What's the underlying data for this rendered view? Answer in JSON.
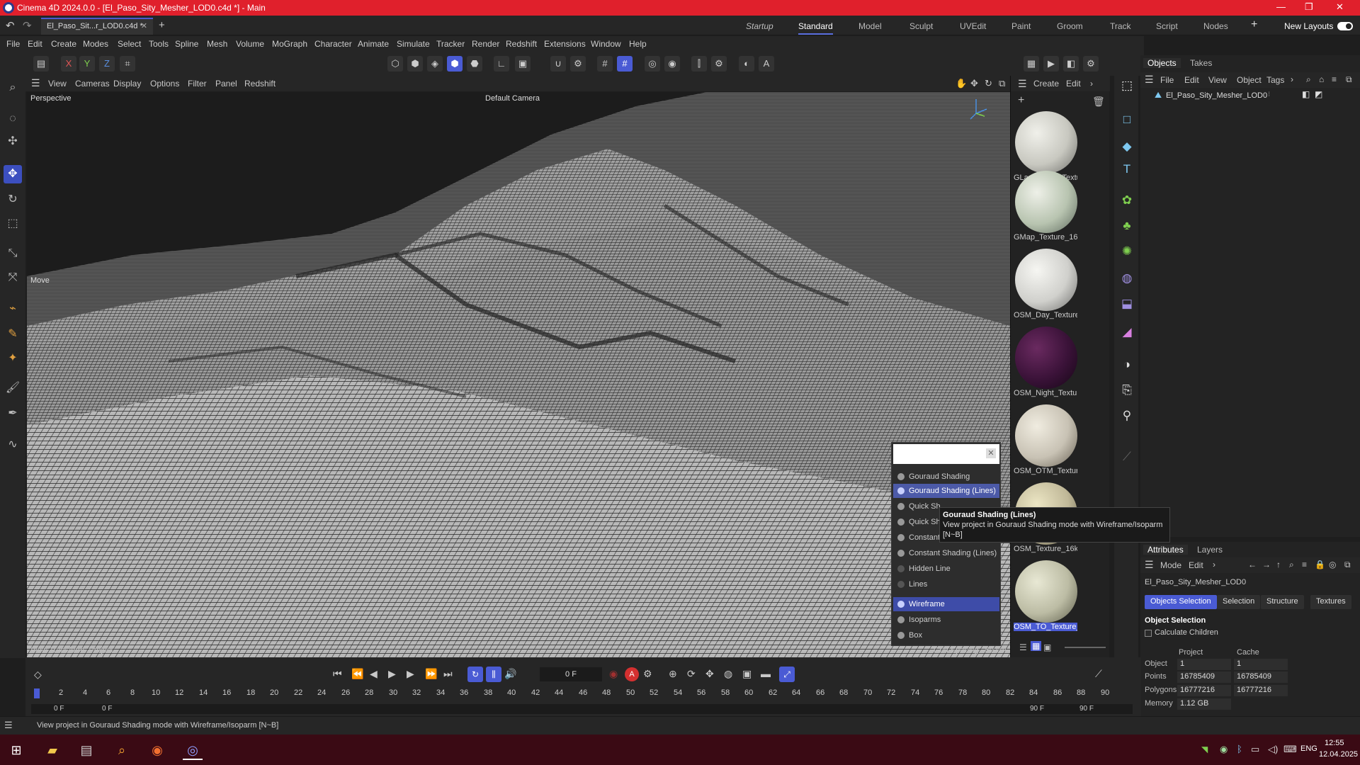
{
  "window": {
    "title": "Cinema 4D 2024.0.0 - [El_Paso_Sity_Mesher_LOD0.c4d *] - Main"
  },
  "doc_tab": {
    "label": "El_Paso_Sit...r_LOD0.c4d *",
    "close": "✕",
    "add": "+"
  },
  "layouts": [
    {
      "label": "Startup",
      "italic": true
    },
    {
      "label": "Standard",
      "active": true
    },
    {
      "label": "Model"
    },
    {
      "label": "Sculpt"
    },
    {
      "label": "UVEdit"
    },
    {
      "label": "Paint"
    },
    {
      "label": "Groom"
    },
    {
      "label": "Track"
    },
    {
      "label": "Script"
    },
    {
      "label": "Nodes"
    }
  ],
  "new_layouts": "New Layouts",
  "menu": [
    "File",
    "Edit",
    "Create",
    "Modes",
    "Select",
    "Tools",
    "Spline",
    "Mesh",
    "Volume",
    "MoGraph",
    "Character",
    "Animate",
    "Simulate",
    "Tracker",
    "Render",
    "Redshift",
    "Extensions",
    "Window",
    "Help"
  ],
  "axes": {
    "x": "X",
    "y": "Y",
    "z": "Z"
  },
  "viewport_menu": [
    "View",
    "Cameras",
    "Display",
    "Options",
    "Filter",
    "Panel",
    "Redshift"
  ],
  "viewport": {
    "projection": "Perspective",
    "camera": "Default Camera",
    "move_label": "Move",
    "view_transform": "View Transform: Project",
    "grid_spacing": "Grid Spacing : 50 cm"
  },
  "shading_menu": {
    "items": [
      {
        "label": "Gouraud Shading"
      },
      {
        "label": "Gouraud Shading (Lines)",
        "highlighted": true
      },
      {
        "label": "Quick Sh"
      },
      {
        "label": "Quick Sh"
      },
      {
        "label": "Constant"
      },
      {
        "label": "Constant Shading (Lines)"
      },
      {
        "label": "Hidden Line"
      },
      {
        "label": "Lines"
      },
      {
        "label": "Wireframe",
        "selected": true
      },
      {
        "label": "Isoparms"
      },
      {
        "label": "Box"
      }
    ]
  },
  "tooltip": {
    "title": "Gouraud Shading (Lines)",
    "line1": "View project in Gouraud Shading  mode with Wireframe/Isoparm",
    "line2": "[N~B]"
  },
  "material_panel": {
    "menu": [
      "Create",
      "Edit"
    ],
    "materials": [
      {
        "label": "GLandscape_Textu",
        "color": "#c8c8c0"
      },
      {
        "label": "GMap_Texture_16",
        "color": "#b8c4b0"
      },
      {
        "label": "OSM_Day_Texture",
        "color": "#d0d0cc"
      },
      {
        "label": "OSM_Night_Textu",
        "color": "#3a1238"
      },
      {
        "label": "OSM_OTM_Textur",
        "color": "#c8c2b4"
      },
      {
        "label": "OSM_Texture_16k",
        "color": "#c0b898"
      },
      {
        "label": "OSM_TO_Texture_",
        "color": "#bcbca4",
        "selected": true
      }
    ]
  },
  "objects_panel": {
    "tabs": [
      "Objects",
      "Takes"
    ],
    "menu": [
      "File",
      "Edit",
      "View",
      "Object",
      "Tags"
    ],
    "items": [
      {
        "label": "El_Paso_Sity_Mesher_LOD0"
      }
    ]
  },
  "attributes_panel": {
    "tabs": [
      "Attributes",
      "Layers"
    ],
    "menu": [
      "Mode",
      "Edit"
    ],
    "object_name": "El_Paso_Sity_Mesher_LOD0",
    "subtabs": [
      {
        "label": "Objects Selection",
        "active": true
      },
      {
        "label": "Selection"
      },
      {
        "label": "Structure"
      },
      {
        "label": "Textures"
      }
    ],
    "section": "Object Selection",
    "checkbox": "Calculate Children",
    "columns": [
      "Project",
      "Cache"
    ],
    "rows": [
      {
        "label": "Object",
        "project": "1",
        "cache": "1"
      },
      {
        "label": "Points",
        "project": "16785409",
        "cache": "16785409"
      },
      {
        "label": "Polygons",
        "project": "16777216",
        "cache": "16777216"
      },
      {
        "label": "Memory",
        "project": "1.12 GB",
        "cache": ""
      }
    ]
  },
  "timeline": {
    "current_frame": "0 F",
    "start": "0 F",
    "start2": "0 F",
    "end": "90 F",
    "end2": "90 F",
    "frames": [
      "0",
      "2",
      "4",
      "6",
      "8",
      "10",
      "12",
      "14",
      "16",
      "18",
      "20",
      "22",
      "24",
      "26",
      "28",
      "30",
      "32",
      "34",
      "36",
      "38",
      "40",
      "42",
      "44",
      "46",
      "48",
      "50",
      "52",
      "54",
      "56",
      "58",
      "60",
      "62",
      "64",
      "66",
      "68",
      "70",
      "72",
      "74",
      "76",
      "78",
      "80",
      "82",
      "84",
      "86",
      "88",
      "90"
    ]
  },
  "status": {
    "text": "View project in Gouraud Shading  mode with Wireframe/Isoparm [N~B]"
  },
  "taskbar": {
    "lang": "ENG",
    "time": "12:55",
    "date": "12.04.2025"
  },
  "colors": {
    "accent": "#4a5bd4",
    "titlebar": "#e0202c"
  }
}
